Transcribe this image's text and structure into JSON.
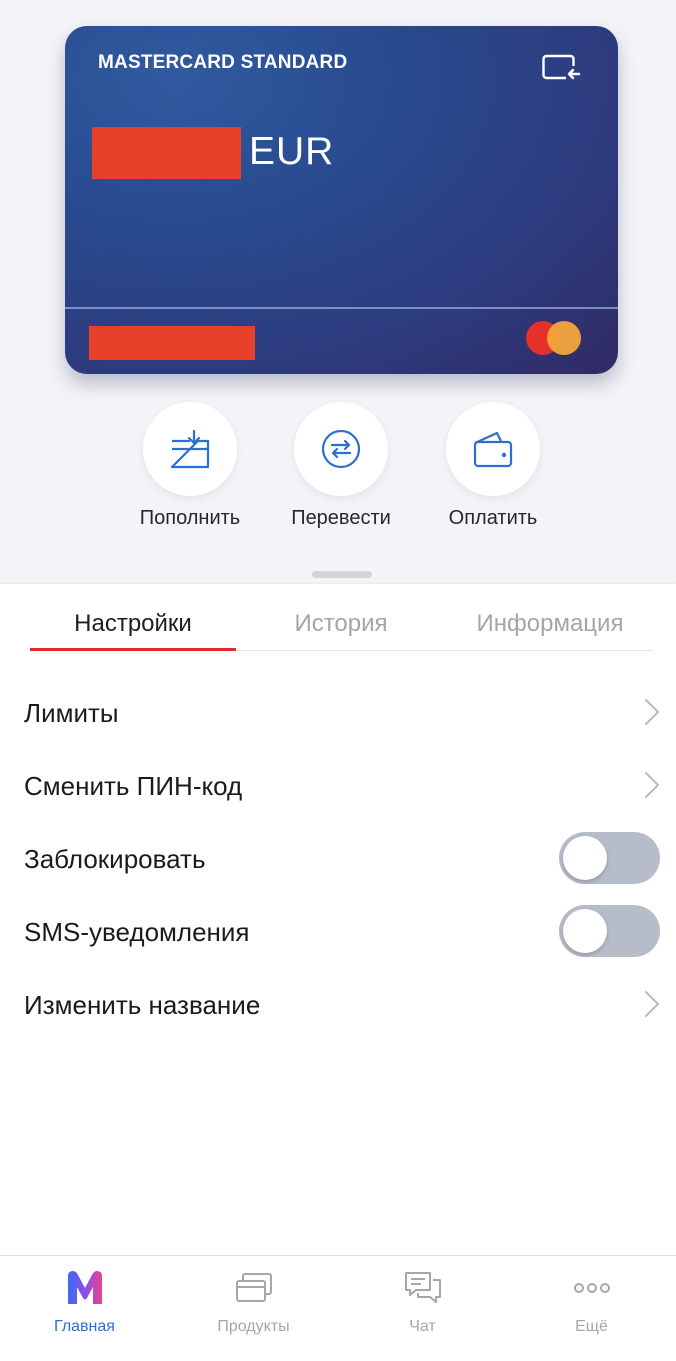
{
  "card": {
    "title": "MASTERCARD STANDARD",
    "currency": "EUR",
    "switch_icon": "card-switch-icon",
    "brand_icon": "mastercard-logo",
    "mask_color": "#e8402a"
  },
  "actions": [
    {
      "label": "Пополнить",
      "icon": "top-up-icon"
    },
    {
      "label": "Перевести",
      "icon": "transfer-icon"
    },
    {
      "label": "Оплатить",
      "icon": "wallet-icon"
    }
  ],
  "tabs": [
    {
      "label": "Настройки",
      "active": true
    },
    {
      "label": "История",
      "active": false
    },
    {
      "label": "Информация",
      "active": false
    }
  ],
  "settings": [
    {
      "label": "Лимиты",
      "control": "chevron"
    },
    {
      "label": "Сменить ПИН-код",
      "control": "chevron"
    },
    {
      "label": "Заблокировать",
      "control": "toggle",
      "on": false
    },
    {
      "label": "SMS-уведомления",
      "control": "toggle",
      "on": false
    },
    {
      "label": "Изменить название",
      "control": "chevron"
    }
  ],
  "tabbar": [
    {
      "label": "Главная",
      "icon": "home-logo-icon",
      "active": true
    },
    {
      "label": "Продукты",
      "icon": "cards-icon",
      "active": false
    },
    {
      "label": "Чат",
      "icon": "chat-icon",
      "active": false
    },
    {
      "label": "Ещё",
      "icon": "more-icon",
      "active": false
    }
  ],
  "colors": {
    "accent_blue": "#2b6fd1",
    "tab_underline": "#e3282d",
    "toggle_off": "#b7bcc9"
  }
}
